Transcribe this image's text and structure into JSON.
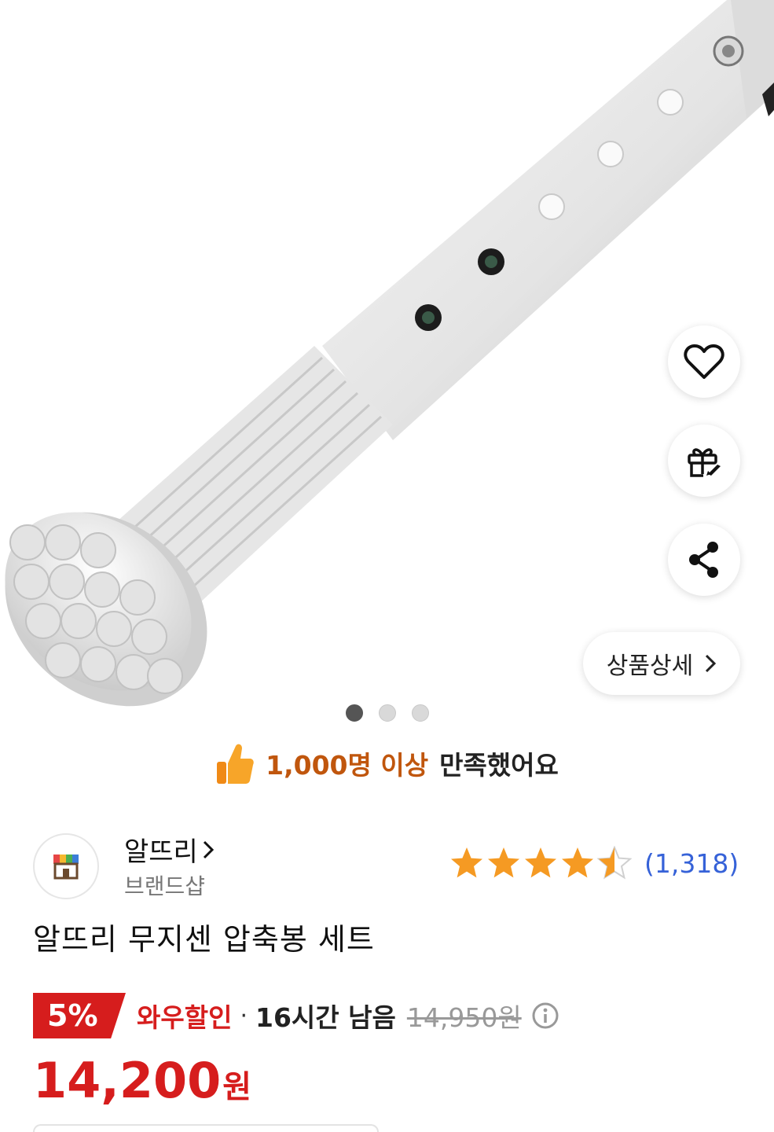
{
  "gallery": {
    "product_image": "tension rod product photo",
    "dots": [
      {
        "active": true
      },
      {
        "active": false
      },
      {
        "active": false
      }
    ],
    "actions": {
      "wishlist_icon": "heart-icon",
      "gift_icon": "gift-rocket-icon",
      "share_icon": "share-icon"
    },
    "detail_button": {
      "label": "상품상세",
      "icon": "chevron-right-icon"
    }
  },
  "satisfaction": {
    "icon": "thumbs-up-icon",
    "highlight": "1,000명 이상",
    "rest": "만족했어요"
  },
  "shop": {
    "name": "알뜨리",
    "name_chevron": "›",
    "type": "브랜드샵"
  },
  "rating": {
    "stars": 4.5,
    "review_count": "(1,318)",
    "star_color": "#f59a23"
  },
  "product": {
    "title": "알뜨리 무지센 압축봉 세트"
  },
  "pricing": {
    "discount_percent": "5%",
    "deal_label": "와우할인",
    "separator": "·",
    "time_left": "16시간 남음",
    "original_price": "14,950원",
    "final_price": "14,200",
    "currency": "원",
    "accent_color": "#d61d1d"
  }
}
